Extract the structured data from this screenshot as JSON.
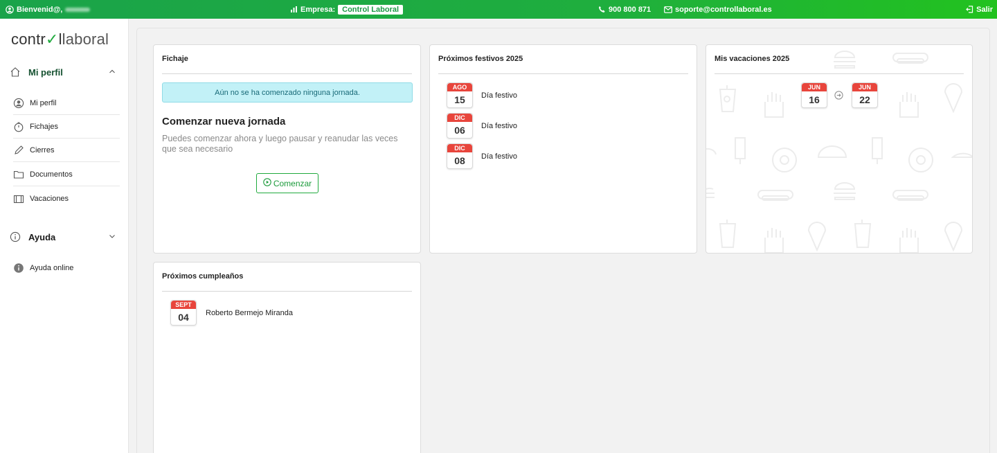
{
  "topbar": {
    "welcome": "Bienvenid@,",
    "company_label": "Empresa:",
    "company_name": "Control Laboral",
    "phone": "900 800 871",
    "email": "soporte@controllaboral.es",
    "logout": "Salir"
  },
  "logo": {
    "part1": "contr",
    "check": "✓",
    "part2": "l",
    "part3": "laboral"
  },
  "sidebar": {
    "perfil_title": "Mi perfil",
    "items": [
      {
        "label": "Mi perfil",
        "icon": "user-circle-icon"
      },
      {
        "label": "Fichajes",
        "icon": "stopwatch-icon"
      },
      {
        "label": "Cierres",
        "icon": "pencil-icon"
      },
      {
        "label": "Documentos",
        "icon": "folder-icon"
      },
      {
        "label": "Vacaciones",
        "icon": "luggage-icon"
      }
    ],
    "ayuda_title": "Ayuda",
    "ayuda_items": [
      {
        "label": "Ayuda online",
        "icon": "info-filled-icon"
      }
    ]
  },
  "fichaje": {
    "title": "Fichaje",
    "alert": "Aún no se ha comenzado ninguna jornada.",
    "start_title": "Comenzar nueva jornada",
    "start_desc": "Puedes comenzar ahora y luego pausar y reanudar las veces que sea necesario",
    "start_button": "Comenzar"
  },
  "festivos": {
    "title": "Próximos festivos 2025",
    "items": [
      {
        "month": "AGO",
        "day": "15",
        "label": "Día festivo"
      },
      {
        "month": "DIC",
        "day": "06",
        "label": "Día festivo"
      },
      {
        "month": "DIC",
        "day": "08",
        "label": "Día festivo"
      }
    ]
  },
  "vacaciones": {
    "title": "Mis vacaciones 2025",
    "from": {
      "month": "JUN",
      "day": "16"
    },
    "to": {
      "month": "JUN",
      "day": "22"
    }
  },
  "cumple": {
    "title": "Próximos cumpleaños",
    "items": [
      {
        "month": "SEPT",
        "day": "04",
        "name": "Roberto Bermejo Miranda"
      }
    ]
  },
  "colors": {
    "brand_green": "#1faa3d",
    "calendar_red": "#e8453c",
    "alert_bg": "#c2f1f7"
  }
}
